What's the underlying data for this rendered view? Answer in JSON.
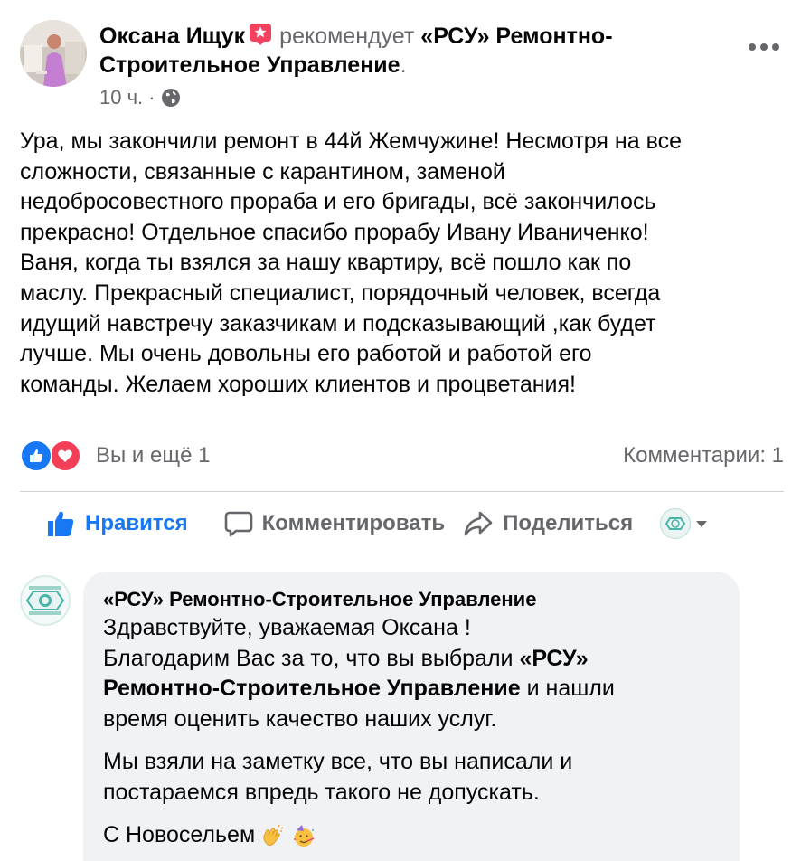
{
  "post": {
    "author_name": "Оксана Ищук",
    "recommend_verb": "рекомендует",
    "page_name": "«РСУ» Ремонтно-Строительное Управление",
    "trailing_dot": ".",
    "time": "10 ч.",
    "time_separator": "·",
    "body_lines": [
      "Ура, мы закончили ремонт в 44й Жемчужине! Несмотря на все",
      "сложности, связанные с карантином, заменой",
      "недобросовестного прораба и его бригады, всё закончилось",
      "прекрасно! Отдельное спасибо  прорабу Ивану Иваниченко!",
      "Ваня, когда ты взялся за нашу квартиру, всё пошло как по",
      "маслу. Прекрасный специалист, порядочный человек, всегда",
      "идущий навстречу заказчикам и подсказывающий ,как будет",
      "лучше. Мы очень довольны его работой и работой его",
      "команды. Желаем хороших клиентов и процветания!"
    ]
  },
  "stats": {
    "reactors_text": "Вы и ещё 1",
    "comments_text": "Комментарии: 1"
  },
  "actions": {
    "like_label": "Нравится",
    "comment_label": "Комментировать",
    "share_label": "Поделиться"
  },
  "comment": {
    "author": "«РСУ» Ремонтно-Строительное Управление",
    "line1": "Здравствуйте, уважаемая Оксана !",
    "line2": "Благодарим Вас за то, что вы выбрали ",
    "line2_bold": "«РСУ»",
    "line3_bold": "Ремонтно-Строительное Управление",
    "line3_rest": " и нашли",
    "line4": "время оценить качество наших услуг.",
    "para2_line1": "Мы взяли на заметку все, что вы написали и",
    "para2_line2": "постараемся впредь такого не допускать.",
    "para3": "С Новосельем"
  },
  "icons": {
    "recommend": "recommend-star-icon",
    "privacy": "globe-icon",
    "more": "more-options-icon",
    "like_reaction": "like-reaction-icon",
    "love_reaction": "love-reaction-icon",
    "like": "thumbs-up-icon",
    "comment": "comment-bubble-icon",
    "share": "share-arrow-icon",
    "emojis": [
      "clapping-hands-emoji",
      "partying-face-emoji"
    ]
  },
  "colors": {
    "brand_blue": "#1877f2",
    "love_red": "#f33e58",
    "recommend_red": "#f3425f",
    "secondary_text": "#65676b",
    "bubble_bg": "#f0f2f5"
  }
}
